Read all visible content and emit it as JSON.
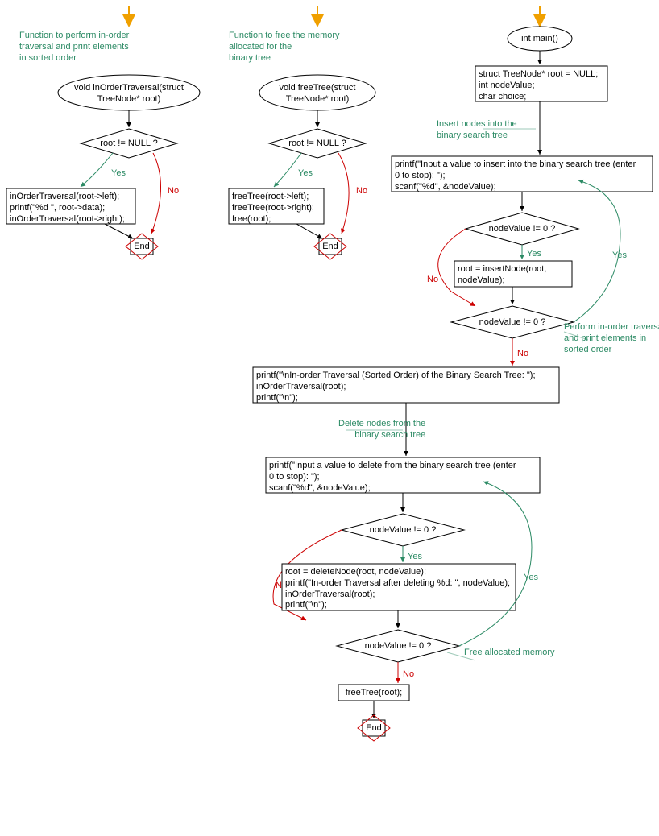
{
  "comments": {
    "c1": "Function to perform in-order\ntraversal and print elements\nin sorted order",
    "c2": "Function to free the memory\nallocated for the\nbinary tree",
    "c3": "Insert nodes into the\nbinary search tree",
    "c4": "Perform in-order traversal\nand print elements in\nsorted order",
    "c5": "Delete nodes from the\nbinary search tree",
    "c6": "Free allocated memory"
  },
  "flow1": {
    "start": "void inOrderTraversal(struct\nTreeNode* root)",
    "cond": "root != NULL ?",
    "body": "inOrderTraversal(root->left);\nprintf(\"%d \", root->data);\ninOrderTraversal(root->right);",
    "end": "End"
  },
  "flow2": {
    "start": "void freeTree(struct\nTreeNode* root)",
    "cond": "root != NULL ?",
    "body": "freeTree(root->left);\nfreeTree(root->right);\nfree(root);",
    "end": "End"
  },
  "main": {
    "start": "int main()",
    "init": "struct TreeNode* root = NULL;\nint nodeValue;\nchar choice;",
    "prompt_insert": "printf(\"Input a value to insert into the binary search tree (enter\n0 to stop): \");\nscanf(\"%d\", &nodeValue);",
    "cond1": "nodeValue != 0 ?",
    "insert": "root = insertNode(root,\nnodeValue);",
    "cond2": "nodeValue != 0 ?",
    "traverse": "printf(\"\\nIn-order Traversal (Sorted Order) of the Binary Search Tree: \");\ninOrderTraversal(root);\nprintf(\"\\n\");",
    "prompt_delete": "printf(\"Input a value to delete from the binary search tree (enter\n0 to stop): \");\nscanf(\"%d\", &nodeValue);",
    "cond3": "nodeValue != 0 ?",
    "delete": "root = deleteNode(root, nodeValue);\nprintf(\"In-order Traversal after deleting %d: \", nodeValue);\ninOrderTraversal(root);\nprintf(\"\\n\");",
    "cond4": "nodeValue != 0 ?",
    "free": "freeTree(root);",
    "end": "End"
  },
  "labels": {
    "yes": "Yes",
    "no": "No"
  }
}
